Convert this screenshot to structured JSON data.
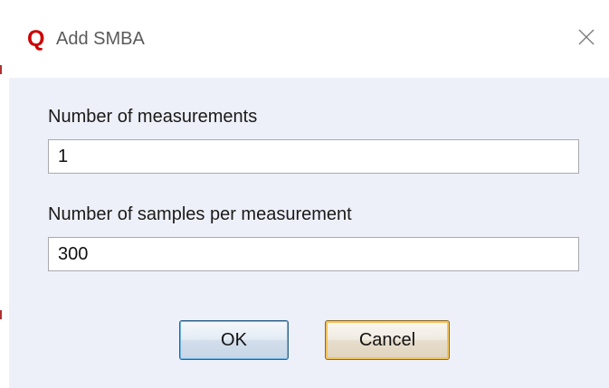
{
  "dialog": {
    "app_logo_letter": "Q",
    "title": "Add SMBA",
    "close_icon": "close-x-icon"
  },
  "fields": {
    "measurements": {
      "label": "Number of measurements",
      "value": "1"
    },
    "samples": {
      "label": "Number of samples per measurement",
      "value": "300"
    }
  },
  "buttons": {
    "ok_label": "OK",
    "cancel_label": "Cancel"
  },
  "colors": {
    "logo": "#cc0000",
    "content_background": "#eef0f9",
    "default_button_border": "#2c628b",
    "focused_button_highlight": "#f3c35a"
  }
}
